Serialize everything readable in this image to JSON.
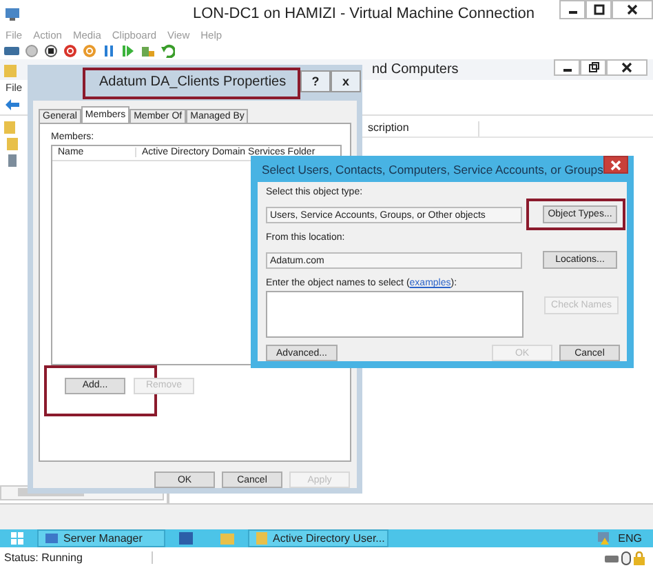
{
  "vm_window": {
    "title": "LON-DC1 on HAMIZI - Virtual Machine Connection",
    "menu": [
      "File",
      "Action",
      "Media",
      "Clipboard",
      "View",
      "Help"
    ]
  },
  "aduc_window": {
    "title": "nd Computers",
    "menu": [
      "File"
    ],
    "column_header": "scription"
  },
  "properties_dialog": {
    "title": "Adatum DA_Clients Properties",
    "title_highlighted": true,
    "help": "?",
    "close": "x",
    "tabs": [
      {
        "label": "General",
        "selected": false
      },
      {
        "label": "Members",
        "selected": true
      },
      {
        "label": "Member Of",
        "selected": false
      },
      {
        "label": "Managed By",
        "selected": false
      }
    ],
    "members_label": "Members:",
    "columns": [
      "Name",
      "Active Directory Domain Services Folder"
    ],
    "list_buttons": [
      {
        "label": "Add...",
        "disabled": false,
        "highlighted": true
      },
      {
        "label": "Remove",
        "disabled": true,
        "highlighted": false
      }
    ],
    "footer_buttons": [
      {
        "label": "OK",
        "disabled": false
      },
      {
        "label": "Cancel",
        "disabled": false
      },
      {
        "label": "Apply",
        "disabled": true
      }
    ]
  },
  "select_dialog": {
    "title": "Select Users, Contacts, Computers, Service Accounts, or Groups",
    "rows": [
      {
        "label": "Select this object type:",
        "value": "Users, Service Accounts, Groups, or Other objects",
        "button": "Object Types...",
        "highlighted": true
      },
      {
        "label": "From this location:",
        "value": "Adatum.com",
        "button": "Locations...",
        "highlighted": false
      }
    ],
    "names_label": "Enter the object names to select (",
    "names_link": "examples",
    "names_label_end": "):",
    "check_button": {
      "label": "Check Names",
      "disabled": true
    },
    "footer_buttons": [
      {
        "label": "Advanced...",
        "disabled": false
      },
      {
        "label": "OK",
        "disabled": true
      },
      {
        "label": "Cancel",
        "disabled": false
      }
    ]
  },
  "taskbar": {
    "items": [
      {
        "label": "Server Manager"
      },
      {
        "label": "Active Directory User..."
      }
    ],
    "language": "ENG"
  },
  "status_bar": {
    "text": "Status: Running"
  }
}
